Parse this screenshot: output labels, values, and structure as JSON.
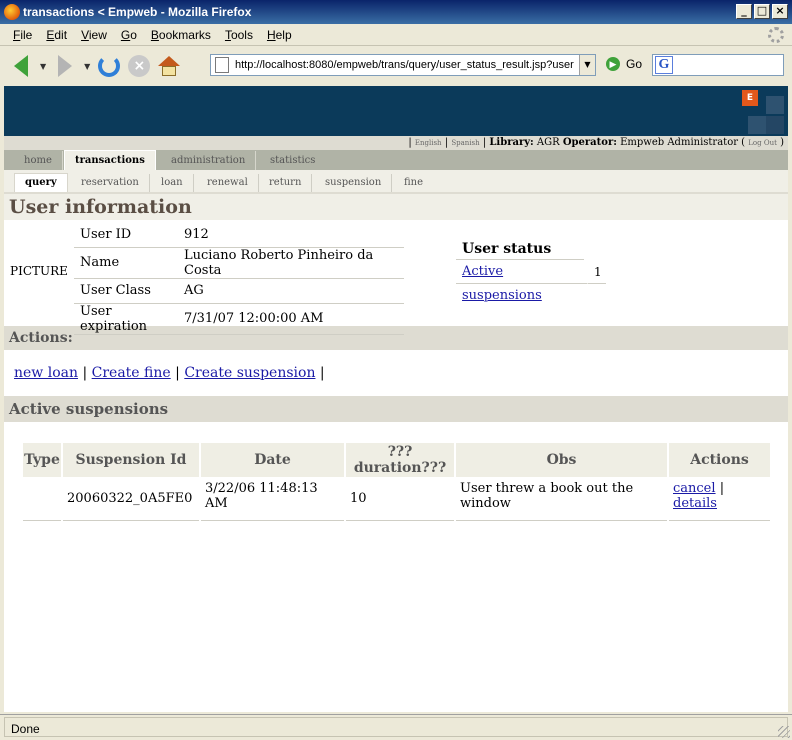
{
  "window": {
    "title": "transactions < Empweb - Mozilla Firefox",
    "controls": [
      "_",
      "□",
      "×"
    ]
  },
  "menubar": {
    "items": [
      {
        "ul": "F",
        "rest": "ile"
      },
      {
        "ul": "E",
        "rest": "dit"
      },
      {
        "ul": "V",
        "rest": "iew"
      },
      {
        "ul": "G",
        "rest": "o"
      },
      {
        "ul": "B",
        "rest": "ookmarks"
      },
      {
        "ul": "T",
        "rest": "ools"
      },
      {
        "ul": "H",
        "rest": "elp"
      }
    ]
  },
  "toolbar": {
    "url": "http://localhost:8080/empweb/trans/query/user_status_result.jsp?user",
    "go_label": "Go",
    "search_value": ""
  },
  "header": {
    "lang_english": "English",
    "lang_spanish": "Spanish",
    "library_label": "Library:",
    "library_value": "AGR",
    "operator_label": "Operator:",
    "operator_value": "Empweb Administrator (",
    "logout": "Log Out",
    "close_paren": ")"
  },
  "tabs": {
    "main": [
      "home",
      "transactions",
      "administration",
      "statistics"
    ],
    "sub": [
      "query",
      "reservation",
      "loan",
      "renewal",
      "return",
      "suspension",
      "fine"
    ]
  },
  "user_info": {
    "heading": "User information",
    "picture_label": "PICTURE",
    "fields": [
      {
        "label": "User ID",
        "value": "912"
      },
      {
        "label": "Name",
        "value": "Luciano Roberto Pinheiro da Costa"
      },
      {
        "label": "User Class",
        "value": "AG"
      },
      {
        "label": "User expiration",
        "value": "7/31/07 12:00:00 AM"
      }
    ],
    "status_title": "User status",
    "status_link": "Active suspensions",
    "status_count": "1"
  },
  "actions": {
    "heading": "Actions:",
    "links": [
      "new loan",
      "Create fine",
      "Create suspension"
    ],
    "sep": "|"
  },
  "active_suspensions": {
    "heading": "Active suspensions",
    "columns": [
      "Type",
      "Suspension Id",
      "Date",
      "???duration???",
      "Obs",
      "Actions"
    ],
    "rows": [
      {
        "type": "",
        "id": "20060322_0A5FE0",
        "date": "3/22/06 11:48:13 AM",
        "duration": "10",
        "obs": "User threw a book out the window",
        "action_cancel": "cancel",
        "action_sep": "|",
        "action_details": "details"
      }
    ]
  },
  "status": {
    "text": "Done"
  },
  "colors": {
    "header_blue": "#0b3a5a",
    "logo_orange": "#e2581c",
    "link": "#1a1aa6",
    "tab_bar": "#b0b3a6"
  }
}
